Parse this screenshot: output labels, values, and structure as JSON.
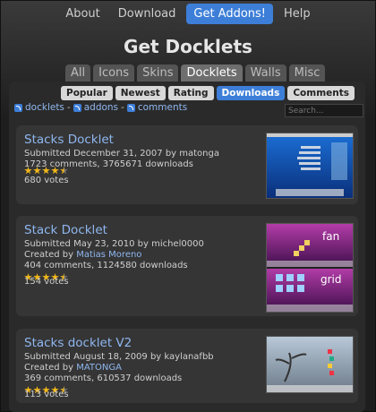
{
  "nav": {
    "items": [
      "About",
      "Download",
      "Get Addons!",
      "Help"
    ]
  },
  "page": {
    "title": "Get Docklets"
  },
  "categories": [
    "All",
    "Icons",
    "Skins",
    "Docklets",
    "Walls",
    "Misc"
  ],
  "sort": [
    "Popular",
    "Newest",
    "Rating",
    "Downloads",
    "Comments"
  ],
  "feeds": {
    "docklets": "docklets",
    "addons": "addons",
    "comments": "comments",
    "dash": "-"
  },
  "search": {
    "placeholder": "Search..."
  },
  "colors": {
    "accent": "#3d7fd8",
    "link": "#8fb7f0",
    "star": "#f2b81a"
  },
  "items": [
    {
      "title": "Stacks Docklet",
      "submitted": "Submitted December 31, 2007 by matonga",
      "stats": "1723 comments, 3765671 downloads",
      "votes": "680 votes",
      "rating": 4.5
    },
    {
      "title": "Stack Docklet",
      "submitted": "Submitted May 23, 2010 by michel0000",
      "created_prefix": "Created by ",
      "created_by": "Matias Moreno",
      "stats": "404 comments, 1124580 downloads",
      "votes": "154 votes",
      "rating": 4.5,
      "thumb_labels": [
        "fan",
        "grid"
      ]
    },
    {
      "title": "Stacks docklet V2",
      "submitted": "Submitted August 18, 2009 by kaylanafbb",
      "created_prefix": "Created by ",
      "created_by": "MATONGA",
      "stats": "369 comments, 610537 downloads",
      "votes": "113 votes",
      "rating": 4.5
    }
  ]
}
